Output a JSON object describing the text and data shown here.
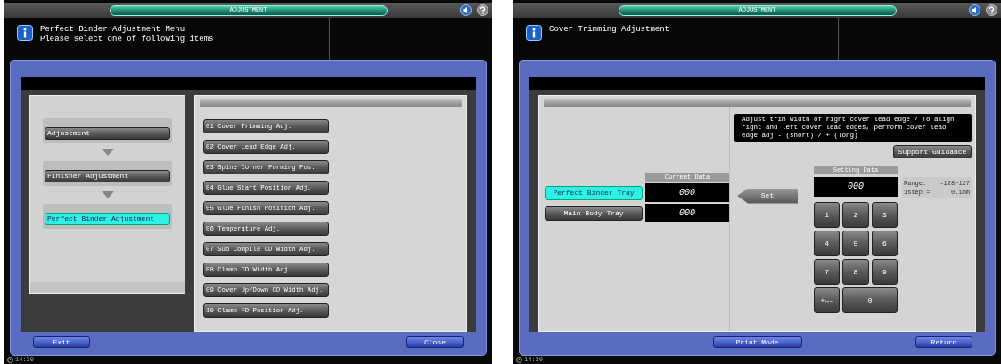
{
  "screens": [
    {
      "kind": "menu",
      "title": "ADJUSTMENT",
      "message": [
        "Perfect Binder Adjustment Menu",
        "Please select one of following items"
      ],
      "breadcrumb": [
        {
          "label": "Adjustment",
          "selected": false
        },
        {
          "label": "Finisher Adjustment",
          "selected": false
        },
        {
          "label": "Perfect Binder Adjustment",
          "selected": true
        }
      ],
      "items": [
        "01 Cover Trimming Adj.",
        "02 Cover Lead Edge Adj.",
        "03 Spine Corner Forming Pos.",
        "04 Glue Start Position Adj.",
        "05 Glue Finish Position Adj.",
        "06 Temperature Adj.",
        "07 Sub Compile CD Width Adj.",
        "08 Clamp CD Width Adj.",
        "09 Cover Up/Down CD Width Adj.",
        "10 Clamp FD Position Adj."
      ],
      "buttons": [
        "Exit",
        "Close"
      ],
      "clock": "14:30"
    },
    {
      "kind": "setting",
      "title": "ADJUSTMENT",
      "message": [
        "Cover Trimming Adjustment"
      ],
      "description": "Adjust trim width of right cover lead edge / To align right and left cover lead edges, perform cover lead edge adj - (short) / + (long)",
      "support_button": "Support Guidance",
      "current_header": "Current Data",
      "trays": [
        {
          "label": "Perfect Binder Tray",
          "selected": true,
          "value": "000"
        },
        {
          "label": "Main Body Tray",
          "selected": false,
          "value": "000"
        }
      ],
      "set_button": "Set",
      "setting_header": "Setting Data",
      "setting_value": "000",
      "range": [
        "Range:",
        "-128~127",
        "1step =",
        "0.1mm"
      ],
      "keys": [
        "1",
        "2",
        "3",
        "4",
        "5",
        "6",
        "7",
        "8",
        "9",
        "+↔-",
        "0"
      ],
      "buttons": [
        "Print Mode",
        "Return"
      ],
      "clock": "14:30"
    }
  ]
}
